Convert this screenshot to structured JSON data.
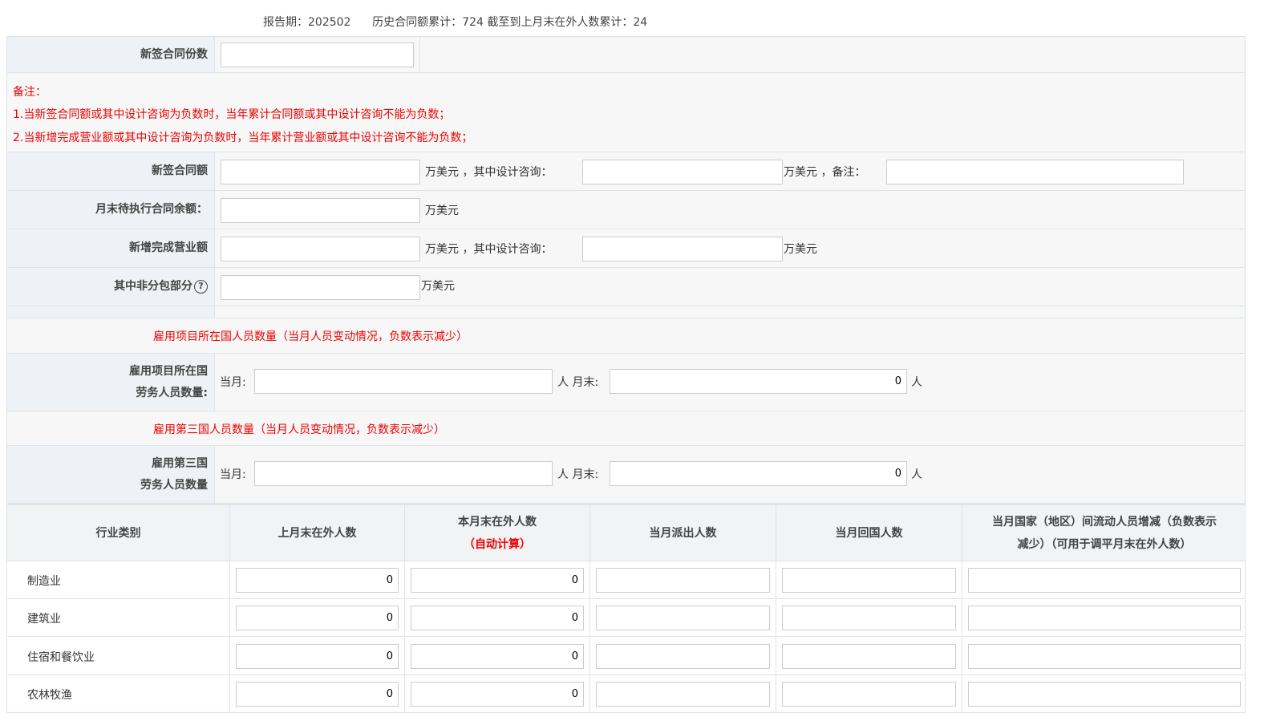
{
  "header": {
    "period": "报告期：202502",
    "history": "历史合同额累计：724 截至到上月末在外人数累计：24"
  },
  "contract_count": {
    "label": "新签合同份数",
    "value": ""
  },
  "notes": {
    "title": "备注：",
    "items": [
      "1.当新签合同额或其中设计咨询为负数时，当年累计合同额或其中设计咨询不能为负数；",
      "2.当新增完成营业额或其中设计咨询为负数时，当年累计营业额或其中设计咨询不能为负数；"
    ]
  },
  "new_contract": {
    "label": "新签合同额",
    "unit1": "万美元 ，其中设计咨询：",
    "unit2": "万美元 ，备注：",
    "value": "",
    "design_value": "",
    "remark": ""
  },
  "balance": {
    "label": "月末待执行合同余额：",
    "unit": "万美元",
    "value": ""
  },
  "revenue": {
    "label": "新增完成营业额",
    "unit1": "万美元 ，其中设计咨询：",
    "unit2": "万美元",
    "value": "",
    "design_value": ""
  },
  "non_sub": {
    "label": "其中非分包部分",
    "help": "?",
    "unit": "万美元",
    "value": ""
  },
  "local": {
    "section": "雇用项目所在国人员数量（当月人员变动情况，负数表示减少）",
    "label1": "雇用项目所在国",
    "label2": "劳务人员数量:",
    "month": "当月:",
    "person_end": "人 月末:",
    "person": "人",
    "month_value": "",
    "end_value": "0"
  },
  "third": {
    "section": "雇用第三国人员数量（当月人员变动情况，负数表示减少）",
    "label1": "雇用第三国",
    "label2": "劳务人员数量",
    "month": "当月:",
    "person_end": "人 月末:",
    "person": "人",
    "month_value": "",
    "end_value": "0"
  },
  "table": {
    "headers": [
      "行业类别",
      "上月末在外人数",
      "本月末在外人数",
      "当月派出人数",
      "当月回国人数",
      "当月国家（地区）间流动人员增减（负数表示"
    ],
    "auto": "（自动计算）",
    "h5b": "减少）（可用于调平月末在外人数）",
    "rows": [
      {
        "name": "制造业",
        "prev": "0",
        "curr": "0"
      },
      {
        "name": "建筑业",
        "prev": "0",
        "curr": "0"
      },
      {
        "name": "住宿和餐饮业",
        "prev": "0",
        "curr": "0"
      },
      {
        "name": "农林牧渔",
        "prev": "0",
        "curr": "0"
      }
    ]
  }
}
